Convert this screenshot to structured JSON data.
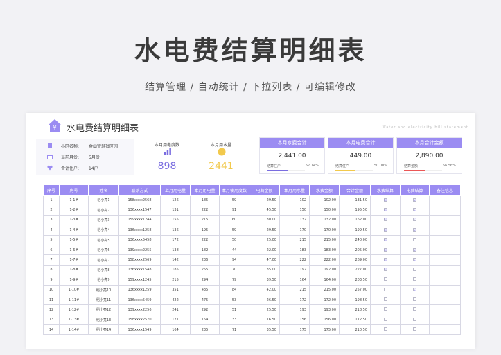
{
  "hero": {
    "title": "水电费结算明细表",
    "subtitle": "结算管理 / 自动统计 / 下拉列表 / 可编辑修改"
  },
  "sheet": {
    "title": "水电费结算明细表",
    "en_title": "Water and electricity bill statement"
  },
  "info": [
    {
      "icon": "building-icon",
      "key": "小区名称:",
      "value": "金山智慧社区园"
    },
    {
      "icon": "calendar-icon",
      "key": "当前月份:",
      "value": "5月份"
    },
    {
      "icon": "heart-icon",
      "key": "合计住户:",
      "value": "14户"
    }
  ],
  "stats": {
    "electric_label": "本月用电度数",
    "electric_value": "898",
    "water_label": "本月用水量",
    "water_value": "2441"
  },
  "cards": [
    {
      "title": "本月水费合计",
      "amount": "2,441.00",
      "label": "结算住户",
      "percent": "57.14%",
      "fill": 0.5714,
      "color": "#7a6de0"
    },
    {
      "title": "本月电费合计",
      "amount": "449.00",
      "label": "结算住户",
      "percent": "50.00%",
      "fill": 0.5,
      "color": "#f2c94c"
    },
    {
      "title": "本月合计金额",
      "amount": "2,890.00",
      "label": "结算金额",
      "percent": "56.56%",
      "fill": 0.5656,
      "color": "#eb5757"
    }
  ],
  "colors": {
    "accent": "#9b8cf2",
    "electric": "#7a6de0",
    "water": "#f2c94c"
  },
  "table": {
    "headers": [
      "序号",
      "房号",
      "姓名",
      "联系方式",
      "上月用电量",
      "本月用电量",
      "本月使用度数",
      "电费金额",
      "本月用水量",
      "水费金额",
      "合计金额",
      "水费结算",
      "电费结算",
      "备注信息"
    ],
    "rows": [
      [
        "1",
        "1-1#",
        "稻小亮1",
        "158xxxx2568",
        "126",
        "185",
        "59",
        "29.50",
        "102",
        "102.00",
        "131.50",
        "☑",
        "☑",
        ""
      ],
      [
        "2",
        "1-2#",
        "稻小亮2",
        "136xxxx1547",
        "131",
        "222",
        "91",
        "45.50",
        "150",
        "150.00",
        "195.50",
        "☑",
        "☑",
        ""
      ],
      [
        "3",
        "1-3#",
        "稻小亮3",
        "159xxxx1244",
        "155",
        "215",
        "60",
        "30.00",
        "132",
        "132.00",
        "162.00",
        "☑",
        "☑",
        ""
      ],
      [
        "4",
        "1-4#",
        "稻小亮4",
        "136xxxx1258",
        "136",
        "195",
        "59",
        "29.50",
        "170",
        "170.00",
        "199.50",
        "☑",
        "☑",
        ""
      ],
      [
        "5",
        "1-5#",
        "稻小亮5",
        "136xxxx5458",
        "172",
        "222",
        "50",
        "25.00",
        "215",
        "215.00",
        "240.00",
        "☑",
        "",
        ""
      ],
      [
        "6",
        "1-6#",
        "稻小亮6",
        "139xxxx2255",
        "138",
        "182",
        "44",
        "22.00",
        "183",
        "183.00",
        "205.00",
        "☑",
        "☑",
        ""
      ],
      [
        "7",
        "1-7#",
        "稻小亮7",
        "158xxxx2569",
        "142",
        "236",
        "94",
        "47.00",
        "222",
        "222.00",
        "269.00",
        "☑",
        "☑",
        ""
      ],
      [
        "8",
        "1-8#",
        "稻小亮8",
        "136xxxx1548",
        "185",
        "255",
        "70",
        "35.00",
        "192",
        "192.00",
        "227.00",
        "☑",
        "",
        ""
      ],
      [
        "9",
        "1-9#",
        "稻小亮9",
        "159xxxx1245",
        "215",
        "294",
        "79",
        "39.50",
        "164",
        "164.00",
        "203.50",
        "",
        "",
        ""
      ],
      [
        "10",
        "1-10#",
        "稻小亮10",
        "136xxxx1259",
        "351",
        "435",
        "84",
        "42.00",
        "215",
        "215.00",
        "257.00",
        "",
        "☑",
        ""
      ],
      [
        "11",
        "1-11#",
        "稻小亮11",
        "136xxxx5459",
        "422",
        "475",
        "53",
        "26.50",
        "172",
        "172.00",
        "198.50",
        "",
        "",
        ""
      ],
      [
        "12",
        "1-12#",
        "稻小亮12",
        "139xxxx2256",
        "241",
        "292",
        "51",
        "25.50",
        "193",
        "193.00",
        "218.50",
        "",
        "",
        ""
      ],
      [
        "13",
        "1-13#",
        "稻小亮13",
        "158xxxx2570",
        "121",
        "154",
        "33",
        "16.50",
        "156",
        "156.00",
        "172.50",
        "",
        "",
        ""
      ],
      [
        "14",
        "1-14#",
        "稻小亮14",
        "136xxxx1549",
        "164",
        "235",
        "71",
        "35.50",
        "175",
        "175.00",
        "210.50",
        "",
        "",
        ""
      ]
    ]
  }
}
